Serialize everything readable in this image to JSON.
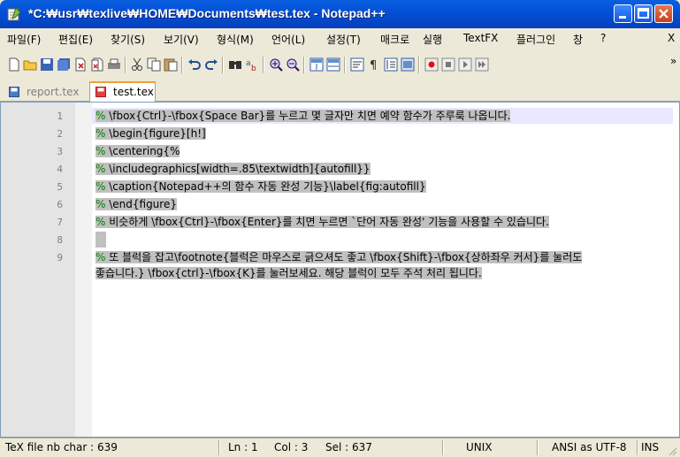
{
  "window": {
    "title": "*C:₩usr₩texlive₩HOME₩Documents₩test.tex - Notepad++"
  },
  "menu": {
    "items": [
      "파일(F)",
      "편집(E)",
      "찾기(S)",
      "보기(V)",
      "형식(M)",
      "언어(L)",
      "설정(T)",
      "매크로",
      "실행",
      "TextFX",
      "플러그인",
      "창",
      "?"
    ],
    "close_glyph": "X",
    "overflow_glyph": "»"
  },
  "tabs": [
    {
      "label": "report.tex",
      "active": false
    },
    {
      "label": "test.tex",
      "active": true
    }
  ],
  "editor": {
    "lines": [
      {
        "num": "1",
        "text": " \\fbox{Ctrl}-\\fbox{Space Bar}를 누르고 몇 글자만 치면 예약 함수가 주루룩 나옵니다."
      },
      {
        "num": "2",
        "text": " \\begin{figure}[h!]"
      },
      {
        "num": "3",
        "text": " \\centering{%"
      },
      {
        "num": "4",
        "text": " \\includegraphics[width=.85\\textwidth]{autofill}}"
      },
      {
        "num": "5",
        "text": " \\caption{Notepad++의 함수 자동 완성 기능}\\label{fig:autofill}"
      },
      {
        "num": "6",
        "text": " \\end{figure}"
      },
      {
        "num": "7",
        "text": " 비슷하게 \\fbox{Ctrl}-\\fbox{Enter}를 치면 누르면 `단어 자동 완성' 기능을 사용할 수 있습니다."
      },
      {
        "num": "8",
        "text": ""
      },
      {
        "num": "9",
        "text": " 또 블럭을 잡고\\footnote{블럭은 마우스로 긁으셔도 좋고 \\fbox{Shift}-\\fbox{상하좌우 커서}를 눌러도"
      },
      {
        "num": "",
        "text": "좋습니다.} \\fbox{ctrl}-\\fbox{K}를 눌러보세요. 해당 블럭이 모두 주석 처리 됩니다."
      }
    ],
    "comment_char": "%"
  },
  "status": {
    "doc_info": "TeX file nb char : 639",
    "ln": "Ln : 1",
    "col": "Col : 3",
    "sel": "Sel : 637",
    "eol": "UNIX",
    "encoding": "ANSI as UTF-8",
    "mode": "INS"
  },
  "colors": {
    "titlebar": "#0451d7",
    "selection": "#c0c0c0",
    "current_line": "#e8e8ff",
    "tab_accent": "#f0a030"
  }
}
